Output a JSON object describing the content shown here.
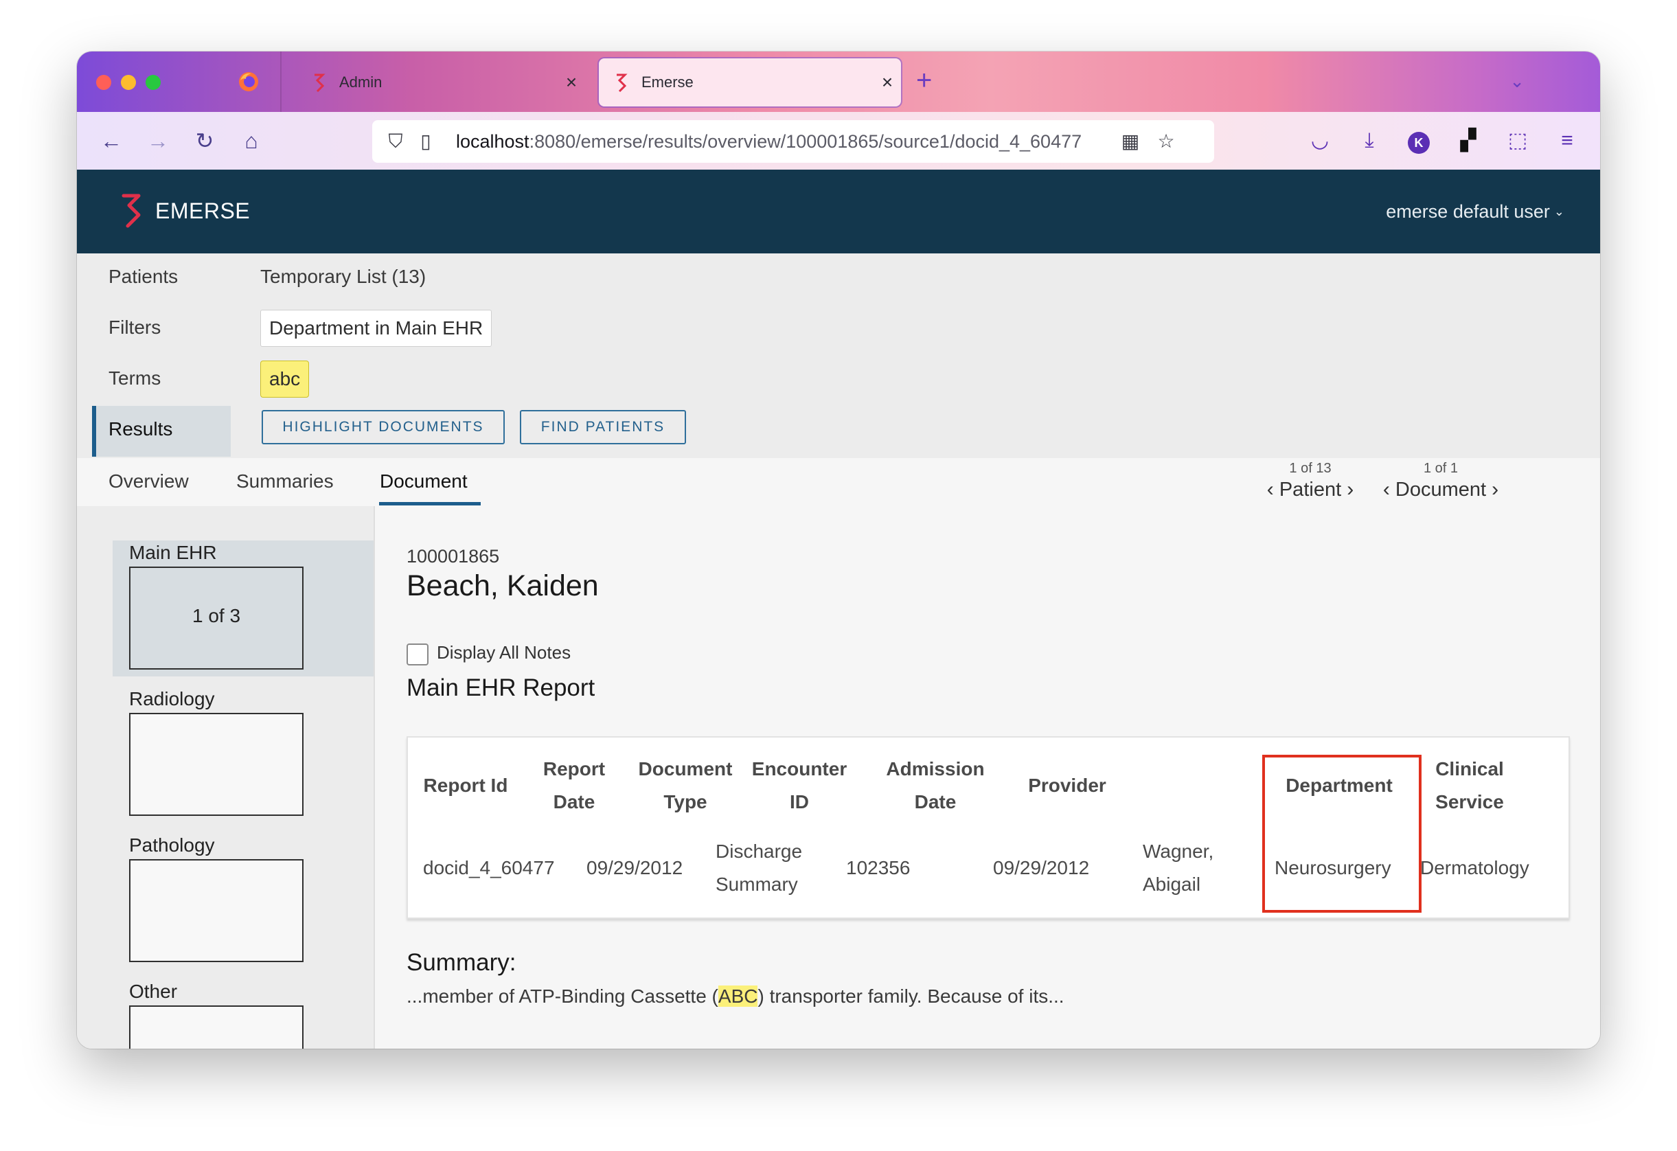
{
  "browser": {
    "tabs": [
      {
        "title": "Admin",
        "active": false
      },
      {
        "title": "Emerse",
        "active": true
      }
    ],
    "url_host": "localhost",
    "url_path": ":8080/emerse/results/overview/100001865/source1/docid_4_60477"
  },
  "app": {
    "brand": "EMERSE",
    "user": "emerse default user"
  },
  "criteria": {
    "patients_label": "Patients",
    "patients_value": "Temporary List (13)",
    "filters_label": "Filters",
    "filters_value": "Department in Main EHR",
    "terms_label": "Terms",
    "terms_value": "abc",
    "results_label": "Results",
    "highlight_btn": "HIGHLIGHT DOCUMENTS",
    "find_btn": "FIND PATIENTS"
  },
  "subtabs": {
    "items": [
      "Overview",
      "Summaries",
      "Document"
    ],
    "active": "Document",
    "patient_pager": {
      "count": "1 of 13",
      "label": "Patient"
    },
    "document_pager": {
      "count": "1 of 1",
      "label": "Document"
    }
  },
  "sources": [
    {
      "label": "Main EHR",
      "count": "1 of 3",
      "active": true
    },
    {
      "label": "Radiology",
      "count": ""
    },
    {
      "label": "Pathology",
      "count": ""
    },
    {
      "label": "Other",
      "count": ""
    }
  ],
  "document": {
    "mrn": "100001865",
    "patient_name": "Beach, Kaiden",
    "display_all_label": "Display All Notes",
    "display_all_checked": false,
    "report_title": "Main EHR Report",
    "columns": {
      "report_id": [
        "Report Id"
      ],
      "report_date": [
        "Report",
        "Date"
      ],
      "document_type": [
        "Document",
        "Type"
      ],
      "encounter_id": [
        "Encounter",
        "ID"
      ],
      "admission_date": [
        "Admission",
        "Date"
      ],
      "provider": [
        "Provider"
      ],
      "department": [
        "Department"
      ],
      "clinical_service": [
        "Clinical",
        "Service"
      ]
    },
    "row": {
      "report_id": "docid_4_60477",
      "report_date": "09/29/2012",
      "document_type": [
        "Discharge",
        "Summary"
      ],
      "encounter_id": "102356",
      "admission_date": "09/29/2012",
      "provider": [
        "Wagner,",
        "Abigail"
      ],
      "department": "Neurosurgery",
      "clinical_service": "Dermatology"
    },
    "summary_title": "Summary:",
    "summary_before": "...member of ATP-Binding Cassette (",
    "summary_highlight": "ABC",
    "summary_after": ") transporter family. Because of its..."
  },
  "colors": {
    "header_bg": "#13374d",
    "accent": "#1c5d8c",
    "term_highlight": "#fbf07a",
    "annotation_box": "#e0301e"
  }
}
